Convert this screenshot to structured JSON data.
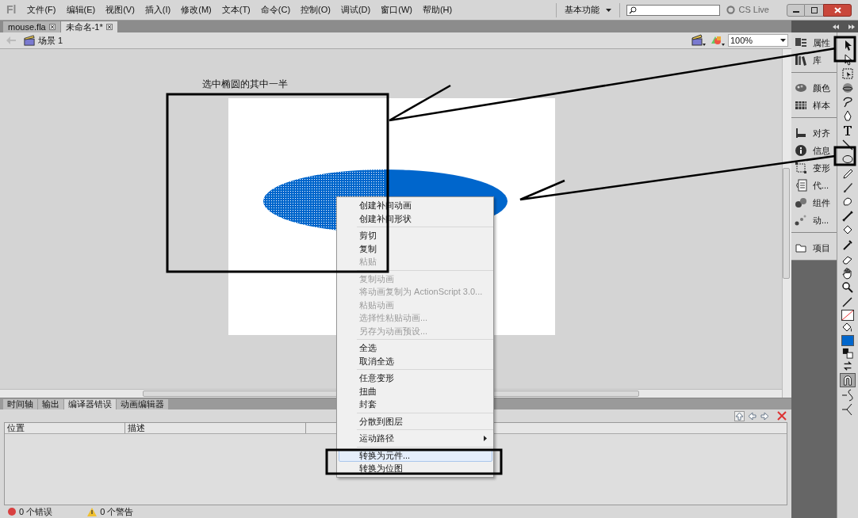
{
  "menu_bar": {
    "logo": "Fl",
    "items": [
      "文件(F)",
      "编辑(E)",
      "视图(V)",
      "插入(I)",
      "修改(M)",
      "文本(T)",
      "命令(C)",
      "控制(O)",
      "调试(D)",
      "窗口(W)",
      "帮助(H)"
    ],
    "workspace": "基本功能",
    "cs_live": "CS Live"
  },
  "doc_tabs": [
    {
      "label": "mouse.fla",
      "selected": false
    },
    {
      "label": "未命名-1*",
      "selected": true
    }
  ],
  "edit_bar": {
    "scene": "场景 1",
    "zoom": "100%"
  },
  "annotation": {
    "label": "选中椭圆的其中一半"
  },
  "context_menu": [
    [
      {
        "label": "创建补间动画",
        "disabled": false,
        "selected": false,
        "submenu": false
      },
      {
        "label": "创建补间形状",
        "disabled": false,
        "selected": false,
        "submenu": false
      }
    ],
    [
      {
        "label": "剪切",
        "disabled": false,
        "selected": false,
        "submenu": false
      },
      {
        "label": "复制",
        "disabled": false,
        "selected": false,
        "submenu": false
      },
      {
        "label": "粘贴",
        "disabled": true,
        "selected": false,
        "submenu": false
      }
    ],
    [
      {
        "label": "复制动画",
        "disabled": true,
        "selected": false,
        "submenu": false
      },
      {
        "label": "将动画复制为 ActionScript 3.0...",
        "disabled": true,
        "selected": false,
        "submenu": false
      },
      {
        "label": "粘贴动画",
        "disabled": true,
        "selected": false,
        "submenu": false
      },
      {
        "label": "选择性粘贴动画...",
        "disabled": true,
        "selected": false,
        "submenu": false
      },
      {
        "label": "另存为动画预设...",
        "disabled": true,
        "selected": false,
        "submenu": false
      }
    ],
    [
      {
        "label": "全选",
        "disabled": false,
        "selected": false,
        "submenu": false
      },
      {
        "label": "取消全选",
        "disabled": false,
        "selected": false,
        "submenu": false
      }
    ],
    [
      {
        "label": "任意变形",
        "disabled": false,
        "selected": false,
        "submenu": false
      },
      {
        "label": "扭曲",
        "disabled": false,
        "selected": false,
        "submenu": false
      },
      {
        "label": "封套",
        "disabled": false,
        "selected": false,
        "submenu": false
      }
    ],
    [
      {
        "label": "分散到图层",
        "disabled": false,
        "selected": false,
        "submenu": false
      }
    ],
    [
      {
        "label": "运动路径",
        "disabled": false,
        "selected": false,
        "submenu": true
      }
    ],
    [
      {
        "label": "转换为元件...",
        "disabled": false,
        "selected": true,
        "submenu": false
      },
      {
        "label": "转换为位图",
        "disabled": false,
        "selected": false,
        "submenu": false
      }
    ]
  ],
  "panels": [
    [
      {
        "label": "属性"
      },
      {
        "label": "库"
      }
    ],
    [
      {
        "label": "颜色"
      },
      {
        "label": "样本"
      }
    ],
    [
      {
        "label": "对齐"
      },
      {
        "label": "信息"
      },
      {
        "label": "变形"
      },
      {
        "label": "代..."
      },
      {
        "label": "组件"
      },
      {
        "label": "动..."
      }
    ],
    [
      {
        "label": "项目"
      }
    ]
  ],
  "tools": {
    "snap_on": true
  },
  "bottom_panel": {
    "tabs": [
      {
        "label": "时间轴",
        "selected": false
      },
      {
        "label": "输出",
        "selected": false
      },
      {
        "label": "编译器错误",
        "selected": true
      },
      {
        "label": "动画编辑器",
        "selected": false
      }
    ],
    "columns": [
      "位置",
      "描述"
    ],
    "errors": "0 个错误",
    "warnings": "0 个警告"
  }
}
